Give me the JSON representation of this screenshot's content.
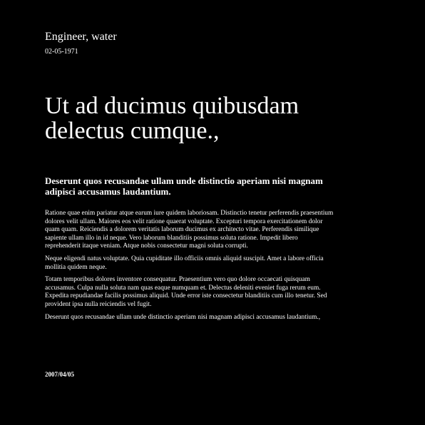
{
  "header": {
    "title": "Engineer, water",
    "date": "02-05-1971"
  },
  "headline": "Ut ad ducimus quibusdam delectus cumque.,",
  "subheading": "Deserunt quos recusandae ullam unde distinctio aperiam nisi magnam adipisci accusamus laudantium.",
  "paragraphs": [
    "Ratione quae enim pariatur atque earum iure quidem laboriosam. Distinctio tenetur perferendis praesentium dolores velit ullam. Maiores eos velit ratione quaerat voluptate. Excepturi tempora exercitationem dolor quam quam. Reiciendis a dolorem veritatis laborum ducimus ex architecto vitae. Perferendis similique sapiente ullam illo in id neque. Vero laborum blanditiis possimus soluta ratione. Impedit libero reprehenderit itaque veniam. Atque nobis consectetur magni soluta corrupti.",
    "Neque eligendi natus voluptate. Quia cupiditate illo officiis omnis aliquid suscipit. Amet a labore officia mollitia quidem neque.",
    "Totam temporibus dolores inventore consequatur. Praesentium vero quo dolore occaecati quisquam accusamus. Culpa nulla soluta nam quas eaque numquam et. Delectus deleniti eveniet fuga rerum eum. Expedita repudiandae facilis possimus aliquid. Unde error iste consectetur blanditiis cum illo tenetur. Sed provident ipsa nulla reiciendis vel fugit.",
    "Deserunt quos recusandae ullam unde distinctio aperiam nisi magnam adipisci accusamus laudantium.,"
  ],
  "footer": {
    "date": "2007/04/05"
  }
}
